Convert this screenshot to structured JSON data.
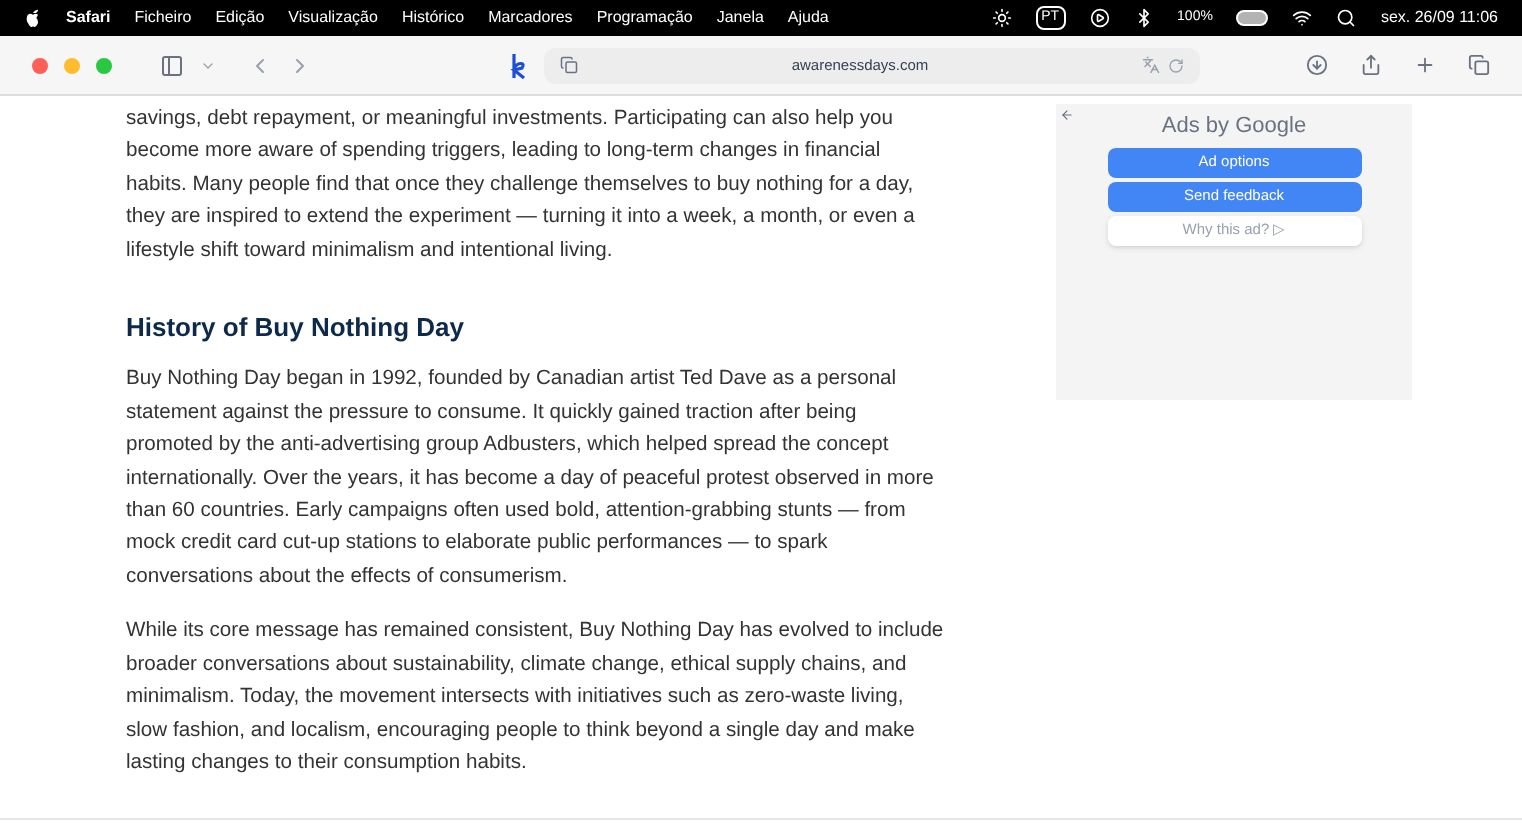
{
  "menu_bar": {
    "app": "Safari",
    "items": [
      "Ficheiro",
      "Edição",
      "Visualização",
      "Histórico",
      "Marcadores",
      "Programação",
      "Janela",
      "Ajuda"
    ],
    "input_source": "PT",
    "battery": "100%",
    "clock": "sex. 26/09 11:06"
  },
  "toolbar": {
    "address": "awarenessdays.com"
  },
  "article": {
    "paragraphs_top": [
      "savings, debt repayment, or meaningful investments. Participating can also help you become more aware of spending triggers, leading to long-term changes in financial habits. Many people find that once they challenge themselves to buy nothing for a day, they are inspired to extend the experiment — turning it into a week, a month, or even a lifestyle shift toward minimalism and intentional living."
    ],
    "heading": "History of Buy Nothing Day",
    "paragraphs": [
      "Buy Nothing Day began in 1992, founded by Canadian artist Ted Dave as a personal statement against the pressure to consume. It quickly gained traction after being promoted by the anti-advertising group Adbusters, which helped spread the concept internationally. Over the years, it has become a day of peaceful protest observed in more than 60 countries. Early campaigns often used bold, attention-grabbing stunts — from mock credit card cut-up stations to elaborate public performances — to spark conversations about the effects of consumerism.",
      "While its core message has remained consistent, Buy Nothing Day has evolved to include broader conversations about sustainability, climate change, ethical supply chains, and minimalism. Today, the movement intersects with initiatives such as zero-waste living, slow fashion, and localism, encouraging people to think beyond a single day and make lasting changes to their consumption habits."
    ]
  },
  "ad_panel": {
    "title": "Ads by Google",
    "buttons": [
      {
        "label": "Ad options",
        "kind": "primary"
      },
      {
        "label": "Send feedback",
        "kind": "primary"
      },
      {
        "label": "Why this ad? ▷",
        "kind": "secondary"
      }
    ]
  }
}
